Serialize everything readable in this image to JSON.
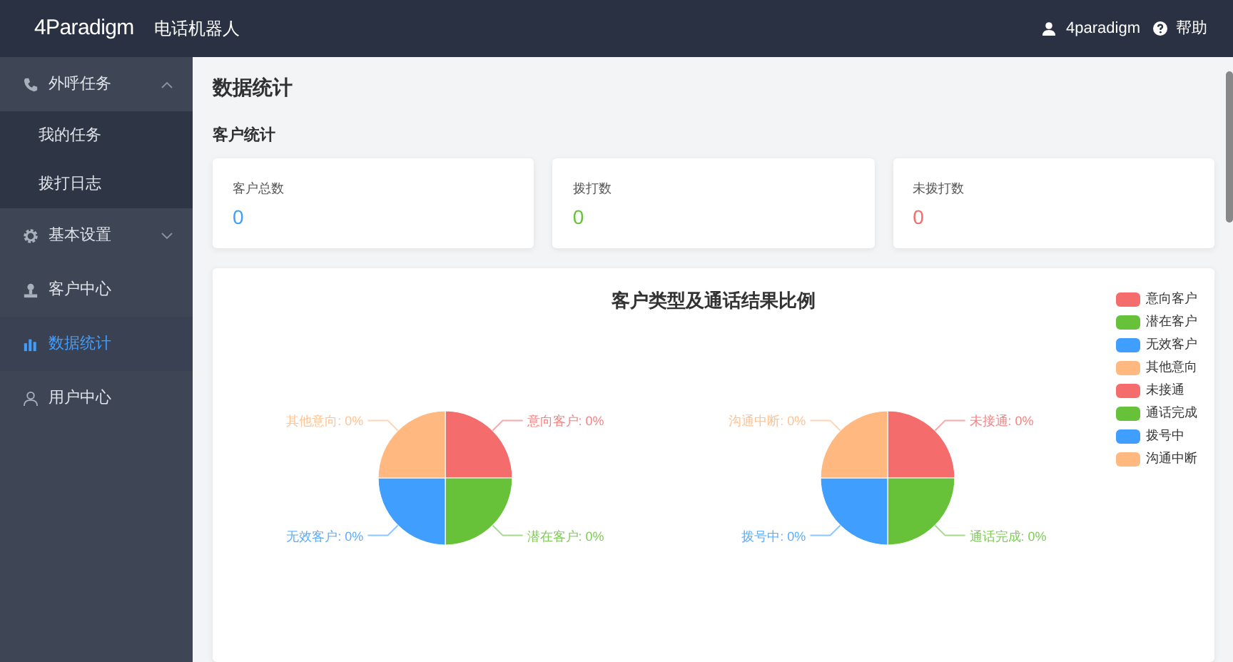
{
  "header": {
    "logo": "4Paradigm",
    "app_title": "电话机器人",
    "user": "4paradigm",
    "help": "帮助"
  },
  "sidebar": {
    "items": [
      {
        "label": "外呼任务",
        "selected": false,
        "expanded": true,
        "children": [
          {
            "label": "我的任务",
            "selected": false
          },
          {
            "label": "拨打日志",
            "selected": false
          }
        ]
      },
      {
        "label": "基本设置",
        "selected": false,
        "expanded": false
      },
      {
        "label": "客户中心",
        "selected": false
      },
      {
        "label": "数据统计",
        "selected": true
      },
      {
        "label": "用户中心",
        "selected": false
      }
    ]
  },
  "page_title": "数据统计",
  "section_title": "客户统计",
  "stats": [
    {
      "label": "客户总数",
      "value": "0",
      "color": "#409eff"
    },
    {
      "label": "拨打数",
      "value": "0",
      "color": "#67c23a"
    },
    {
      "label": "未拨打数",
      "value": "0",
      "color": "#f56c6c"
    }
  ],
  "chart_card": {
    "title": "客户类型及通话结果比例",
    "legend": [
      {
        "label": "意向客户",
        "color": "#f56c6c"
      },
      {
        "label": "潜在客户",
        "color": "#67c23a"
      },
      {
        "label": "无效客户",
        "color": "#409eff"
      },
      {
        "label": "其他意向",
        "color": "#ffb980"
      },
      {
        "label": "未接通",
        "color": "#f56c6c"
      },
      {
        "label": "通话完成",
        "color": "#67c23a"
      },
      {
        "label": "拨号中",
        "color": "#409eff"
      },
      {
        "label": "沟通中断",
        "color": "#ffb980"
      }
    ],
    "charts": [
      {
        "slice_labels": [
          "其他意向: 0%",
          "意向客户: 0%",
          "无效客户: 0%",
          "潜在客户: 0%"
        ]
      },
      {
        "slice_labels": [
          "沟通中断: 0%",
          "未接通: 0%",
          "拨号中: 0%",
          "通话完成: 0%"
        ]
      }
    ]
  }
}
